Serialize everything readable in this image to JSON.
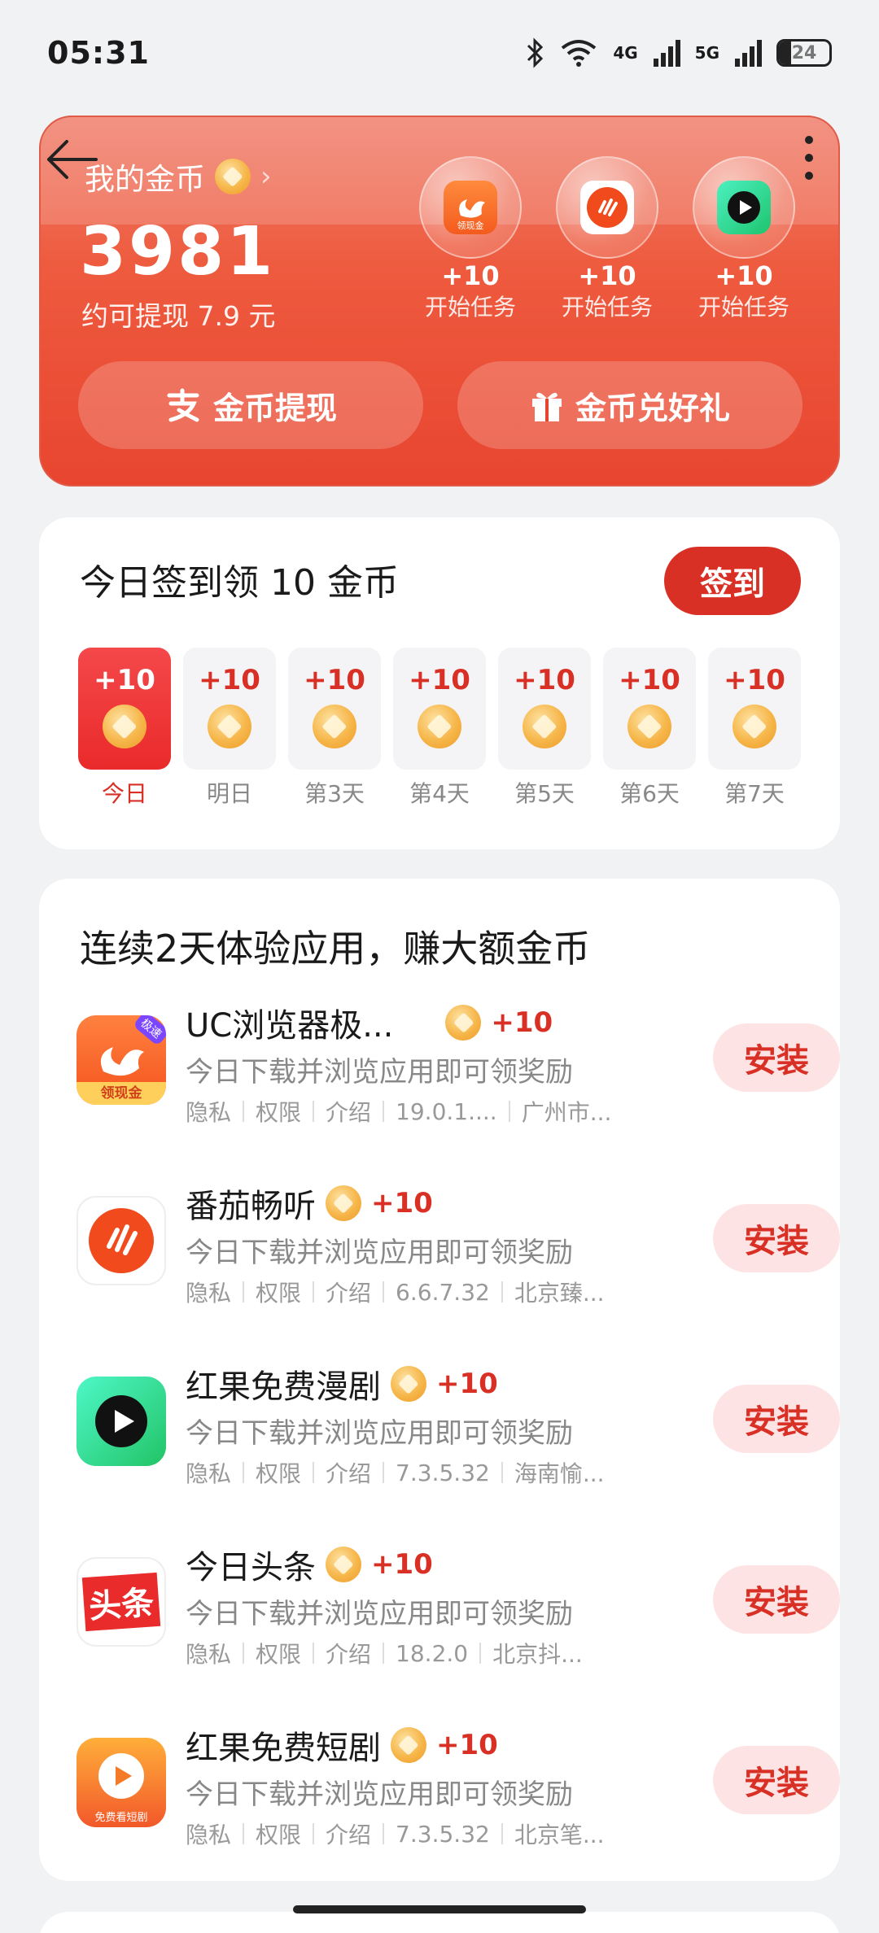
{
  "status_bar": {
    "time": "05:31",
    "signal_4g": "4G",
    "signal_5g": "5G",
    "battery": "24"
  },
  "header": {
    "title": "我的金币",
    "coin_total": "3981",
    "withdraw_hint": "约可提现 7.9 元",
    "tasks": [
      {
        "reward": "+10",
        "label": "开始任务",
        "icon": "uc-browser-icon"
      },
      {
        "reward": "+10",
        "label": "开始任务",
        "icon": "tomato-listen-icon"
      },
      {
        "reward": "+10",
        "label": "开始任务",
        "icon": "hongguo-comic-icon"
      }
    ],
    "task_badge_1": "领现金",
    "btn_withdraw": "金币提现",
    "btn_redeem": "金币兑好礼"
  },
  "checkin": {
    "title": "今日签到领 10 金币",
    "button": "签到",
    "days": [
      {
        "amount": "+10",
        "label": "今日"
      },
      {
        "amount": "+10",
        "label": "明日"
      },
      {
        "amount": "+10",
        "label": "第3天"
      },
      {
        "amount": "+10",
        "label": "第4天"
      },
      {
        "amount": "+10",
        "label": "第5天"
      },
      {
        "amount": "+10",
        "label": "第6天"
      },
      {
        "amount": "+10",
        "label": "第7天"
      }
    ]
  },
  "apps": {
    "title": "连续2天体验应用，赚大额金币",
    "items": [
      {
        "name": "UC浏览器极...",
        "reward": "+10",
        "desc": "今日下载并浏览应用即可领奖励",
        "privacy": "隐私",
        "perm": "权限",
        "intro": "介绍",
        "version": "19.0.1....",
        "dev": "广州市...",
        "install": "安装",
        "icon_badge": "极速",
        "icon_text": "领现金"
      },
      {
        "name": "番茄畅听",
        "reward": "+10",
        "desc": "今日下载并浏览应用即可领奖励",
        "privacy": "隐私",
        "perm": "权限",
        "intro": "介绍",
        "version": "6.6.7.32",
        "dev": "北京臻...",
        "install": "安装"
      },
      {
        "name": "红果免费漫剧",
        "reward": "+10",
        "desc": "今日下载并浏览应用即可领奖励",
        "privacy": "隐私",
        "perm": "权限",
        "intro": "介绍",
        "version": "7.3.5.32",
        "dev": "海南愉...",
        "install": "安装"
      },
      {
        "name": "今日头条",
        "reward": "+10",
        "desc": "今日下载并浏览应用即可领奖励",
        "privacy": "隐私",
        "perm": "权限",
        "intro": "介绍",
        "version": "18.2.0",
        "dev": "北京抖...",
        "install": "安装",
        "icon_text": "头条"
      },
      {
        "name": "红果免费短剧",
        "reward": "+10",
        "desc": "今日下载并浏览应用即可领奖励",
        "privacy": "隐私",
        "perm": "权限",
        "intro": "介绍",
        "version": "7.3.5.32",
        "dev": "北京笔...",
        "install": "安装",
        "icon_text": "免费看短剧"
      }
    ]
  },
  "colors": {
    "accent": "#d93026",
    "header_top": "#f07e6b",
    "header_bottom": "#e8452f",
    "install_bg": "#fde3e3"
  }
}
